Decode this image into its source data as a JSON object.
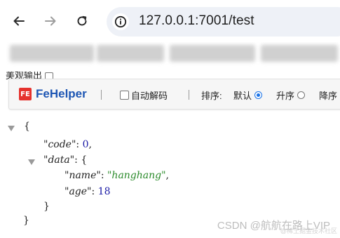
{
  "browser": {
    "url": "127.0.0.1:7001/test",
    "back_icon": "arrow-left-icon",
    "forward_icon": "arrow-right-icon",
    "reload_icon": "reload-icon",
    "info_icon": "info-icon"
  },
  "raw_output": {
    "label": "美观输出"
  },
  "fehelper": {
    "logo_text": "FE",
    "title": "FeHelper",
    "auto_decode_label": "自动解码",
    "sort_label": "排序:",
    "sort_options": [
      {
        "label": "默认",
        "checked": true
      },
      {
        "label": "升序",
        "checked": false
      },
      {
        "label": "降序",
        "checked": false
      }
    ]
  },
  "json": {
    "open_brace": "{",
    "code_key": "\"code\"",
    "code_value": "0",
    "data_key": "\"data\"",
    "data_open": "{",
    "name_key": "\"name\"",
    "name_value": "\"hanghang\"",
    "age_key": "\"age\"",
    "age_value": "18",
    "data_close": "}",
    "close_brace": "}"
  },
  "watermark": {
    "text": "CSDN @航航在路上VIP",
    "sub_text": "@稀土掘金技术社区"
  }
}
